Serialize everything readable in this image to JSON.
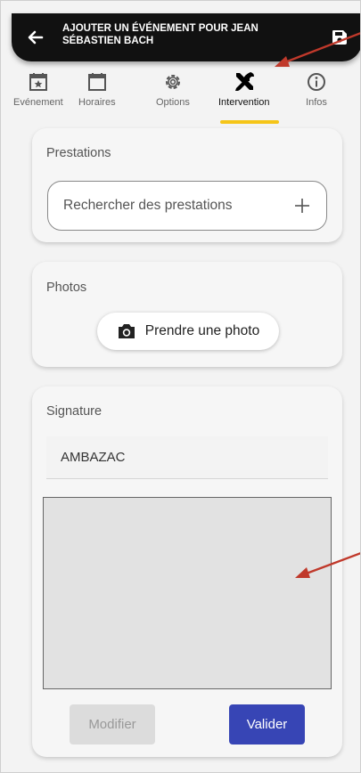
{
  "header": {
    "title": "AJOUTER UN ÉVÉNEMENT POUR JEAN SÉBASTIEN BACH",
    "back_icon": "arrow-left-icon",
    "save_icon": "floppy-save-icon"
  },
  "tabs": [
    {
      "label": "Evénement",
      "icon": "calendar-star-icon",
      "active": false
    },
    {
      "label": "Horaires",
      "icon": "calendar-icon",
      "active": false
    },
    {
      "label": "Options",
      "icon": "gear-icon",
      "active": false
    },
    {
      "label": "Intervention",
      "icon": "tools-icon",
      "active": true
    },
    {
      "label": "Infos",
      "icon": "info-icon",
      "active": false
    }
  ],
  "prestations": {
    "title": "Prestations",
    "search_placeholder": "Rechercher des prestations",
    "add_icon": "plus-icon"
  },
  "photos": {
    "title": "Photos",
    "button_label": "Prendre une photo",
    "button_icon": "camera-icon"
  },
  "signature": {
    "title": "Signature",
    "name_value": "AMBAZAC",
    "modify_label": "Modifier",
    "validate_label": "Valider"
  },
  "colors": {
    "header_bg": "#111111",
    "tab_underline": "#f5c518",
    "validate_bg": "#3745b5",
    "annotation_arrow": "#c0392b"
  }
}
